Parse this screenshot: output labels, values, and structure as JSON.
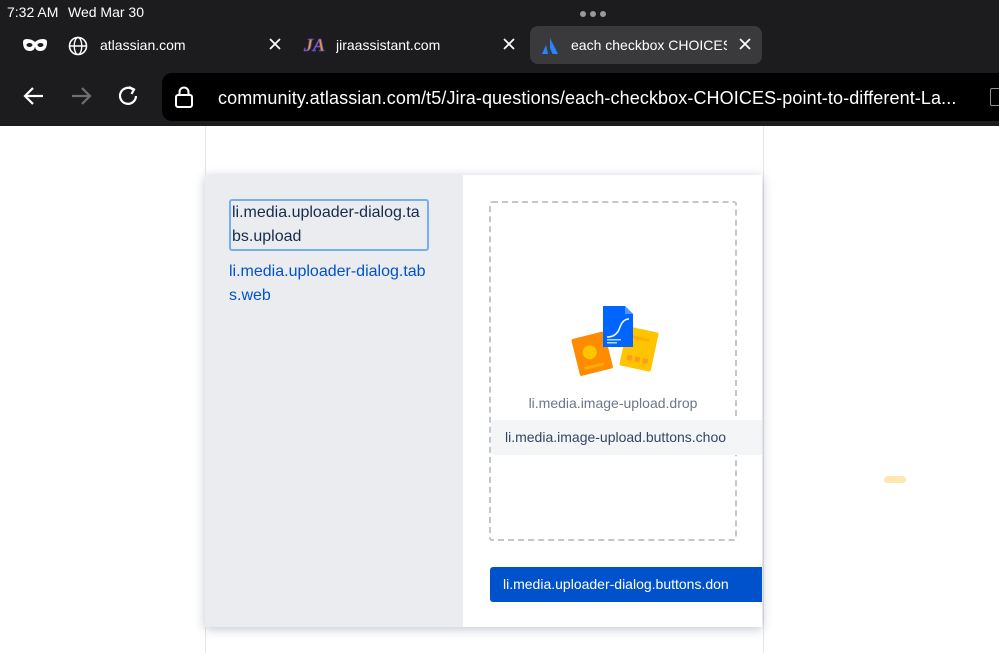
{
  "status_bar": {
    "time": "7:32 AM",
    "date": "Wed Mar 30"
  },
  "tabs": [
    {
      "label": "atlassian.com",
      "icon": "globe-icon"
    },
    {
      "label": "jiraassistant.com",
      "icon": "jira-assistant-favicon"
    },
    {
      "label": "each checkbox CHOICES po",
      "icon": "atlassian-favicon",
      "active": true
    }
  ],
  "address_bar": {
    "url": "community.atlassian.com/t5/Jira-questions/each-checkbox-CHOICES-point-to-different-La..."
  },
  "dialog": {
    "sidebar": {
      "upload_tab": "li.media.uploader-dialog.tabs.upload",
      "web_tab": "li.media.uploader-dialog.tabs.web"
    },
    "drop_text": "li.media.image-upload.drop",
    "choose_button": "li.media.image-upload.buttons.choo",
    "done_button": "li.media.uploader-dialog.buttons.don"
  },
  "colors": {
    "chrome_bg": "#1c1c1e",
    "accent": "#0052cc",
    "sidebar_bg": "#ebecf0"
  }
}
